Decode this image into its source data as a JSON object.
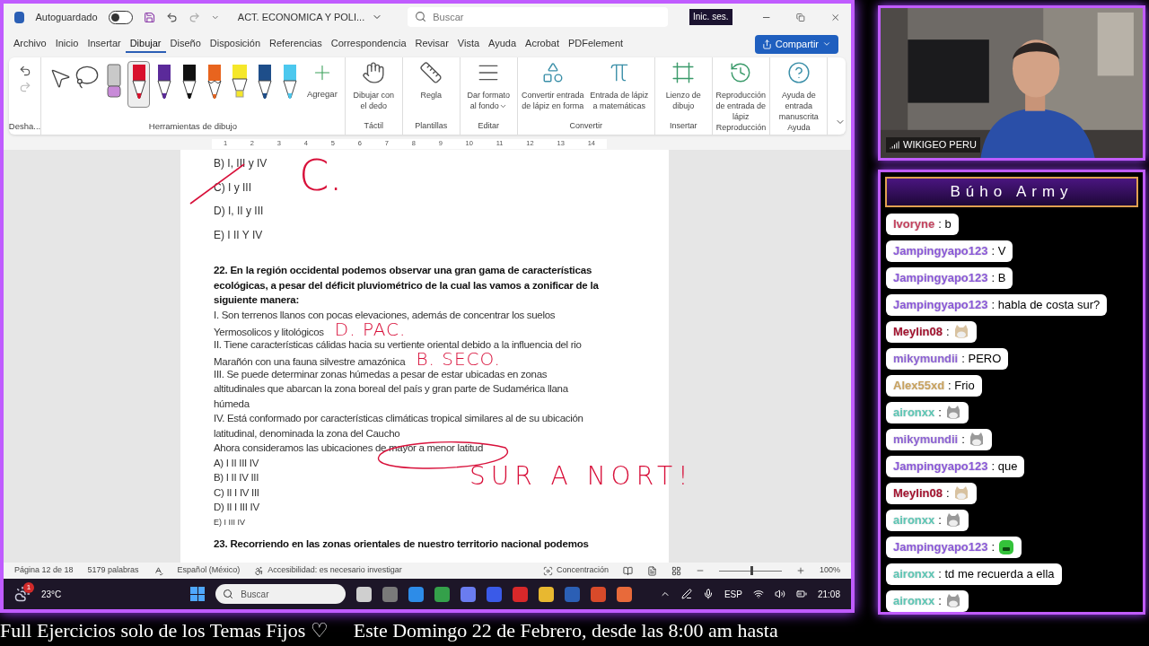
{
  "word": {
    "title_bar": {
      "autosave_label": "Autoguardado",
      "autosave_on": false,
      "doc_title": "ACT. ECONOMICA Y POLI...",
      "search_placeholder": "Buscar",
      "sign_in": "Inic. ses."
    },
    "menu": [
      {
        "label": "Archivo",
        "selected": false
      },
      {
        "label": "Inicio",
        "selected": false
      },
      {
        "label": "Insertar",
        "selected": false
      },
      {
        "label": "Dibujar",
        "selected": true
      },
      {
        "label": "Diseño",
        "selected": false
      },
      {
        "label": "Disposición",
        "selected": false
      },
      {
        "label": "Referencias",
        "selected": false
      },
      {
        "label": "Correspondencia",
        "selected": false
      },
      {
        "label": "Revisar",
        "selected": false
      },
      {
        "label": "Vista",
        "selected": false
      },
      {
        "label": "Ayuda",
        "selected": false
      },
      {
        "label": "Acrobat",
        "selected": false
      },
      {
        "label": "PDFelement",
        "selected": false
      }
    ],
    "share": "Compartir",
    "ribbon": {
      "undo_group": "Desha...",
      "tools_group": "Herramientas de dibujo",
      "add_label": "Agregar",
      "pens": [
        {
          "kind": "eraser",
          "color": "#c9c9c9",
          "selected": false
        },
        {
          "kind": "pen",
          "color": "#d8102c",
          "selected": true
        },
        {
          "kind": "pen",
          "color": "#5b2a9a",
          "selected": false
        },
        {
          "kind": "pen",
          "color": "#111111",
          "selected": false
        },
        {
          "kind": "pencil",
          "color": "#e8641e",
          "selected": false
        },
        {
          "kind": "highlighter",
          "color": "#f5e72a",
          "selected": false
        },
        {
          "kind": "pen",
          "color": "#1e4e8a",
          "selected": false
        },
        {
          "kind": "pen",
          "color": "#4cc8ee",
          "selected": false
        }
      ],
      "groups": [
        {
          "label": "Táctil",
          "buttons": [
            {
              "kind": "finger",
              "label": "Dibujar con el dedo"
            }
          ]
        },
        {
          "label": "Plantillas",
          "buttons": [
            {
              "kind": "ruler",
              "label": "Regla"
            }
          ]
        },
        {
          "label": "Editar",
          "buttons": [
            {
              "kind": "background",
              "label": "Dar formato al fondo",
              "menu": true
            }
          ]
        },
        {
          "label": "Convertir",
          "buttons": [
            {
              "kind": "shape",
              "label": "Convertir entrada de lápiz en forma"
            },
            {
              "kind": "math",
              "label": "Entrada de lápiz a matemáticas"
            }
          ]
        },
        {
          "label": "Insertar",
          "buttons": [
            {
              "kind": "canvas",
              "label": "Lienzo de dibujo"
            }
          ]
        },
        {
          "label": "Reproducción",
          "buttons": [
            {
              "kind": "replay",
              "label": "Reproducción de entrada de lápiz"
            }
          ]
        },
        {
          "label": "Ayuda",
          "buttons": [
            {
              "kind": "help",
              "label": "Ayuda de entrada manuscrita"
            }
          ]
        }
      ]
    },
    "ruler": [
      "1",
      "2",
      "3",
      "4",
      "5",
      "6",
      "7",
      "8",
      "9",
      "10",
      "11",
      "12",
      "13",
      "14"
    ],
    "document": {
      "lines": [
        {
          "kind": "option",
          "text": "B) I, III y IV",
          "struck": false
        },
        {
          "kind": "option",
          "text": "C) I y III",
          "struck": true
        },
        {
          "kind": "option",
          "text": "D) I, II y III",
          "struck": false
        },
        {
          "kind": "option",
          "text": "E) I II Y IV",
          "struck": false
        },
        {
          "kind": "question",
          "text": "22. En la región occidental podemos observar una gran gama de características"
        },
        {
          "kind": "question",
          "text": "ecológicas, a pesar del déficit pluviométrico de la cual las vamos a zonificar de la"
        },
        {
          "kind": "question",
          "text": "siguiente manera:"
        },
        {
          "kind": "body",
          "text": "I. Son terrenos llanos con pocas elevaciones, además de concentrar los suelos"
        },
        {
          "kind": "body",
          "text": "Yermosolicos y litológicos",
          "ink": "D. PAC."
        },
        {
          "kind": "body",
          "text": "II. Tiene características cálidas hacia su vertiente oriental debido a la influencia del rio"
        },
        {
          "kind": "body",
          "text": "Marañón con una fauna silvestre amazónica",
          "ink": "B. SECO."
        },
        {
          "kind": "body",
          "text": "III. Se puede determinar zonas húmedas a pesar de estar ubicadas en zonas"
        },
        {
          "kind": "body",
          "text": "altitudinales que abarcan la zona boreal del país y gran parte de Sudamérica llana"
        },
        {
          "kind": "body",
          "text": "húmeda"
        },
        {
          "kind": "body",
          "text": "IV. Está conformado por características climáticas tropical similares al de su ubicación"
        },
        {
          "kind": "body",
          "text": "latitudinal, denominada la zona del Caucho"
        },
        {
          "kind": "body",
          "text": "Ahora consideramos las ubicaciones de mayor a menor latitud",
          "circled": true
        },
        {
          "kind": "body",
          "text": "A) I II III IV"
        },
        {
          "kind": "body",
          "text": "B) I II IV III"
        },
        {
          "kind": "body",
          "text": "C) II I IV III"
        },
        {
          "kind": "body",
          "text": "D) II I III IV"
        },
        {
          "kind": "small",
          "text": "E) I III IV"
        },
        {
          "kind": "question",
          "text": "23. Recorriendo en las zonas orientales de nuestro territorio nacional podemos"
        }
      ],
      "answer_ink": "C.",
      "note_ink": "SUR A NORT!"
    },
    "status_bar": {
      "page": "Página 12 de 18",
      "words": "5179 palabras",
      "language": "Español (México)",
      "accessibility": "Accesibilidad: es necesario investigar",
      "focus": "Concentración",
      "zoom": {
        "level": 0.5,
        "reading": "100%"
      }
    }
  },
  "taskbar": {
    "weather_badge": "1",
    "temperature": "23°C",
    "search_placeholder": "Buscar",
    "language": "ESP",
    "time": "21:08"
  },
  "webcam": {
    "label": "WIKIGEO PERU"
  },
  "chat": {
    "title": "Búho Army",
    "messages": [
      {
        "user": "Ivoryne",
        "color": "#c4425e",
        "kind": "text",
        "text": ": b"
      },
      {
        "user": "Jampingyapo123",
        "color": "#8a58d8",
        "kind": "text",
        "text": ": V"
      },
      {
        "user": "Jampingyapo123",
        "color": "#8a58d8",
        "kind": "text",
        "text": ": B"
      },
      {
        "user": "Jampingyapo123",
        "color": "#8a58d8",
        "kind": "text",
        "text": ": habla de costa sur?"
      },
      {
        "user": "Meylin08",
        "color": "#a3122e",
        "kind": "beige-cat",
        "text": ":"
      },
      {
        "user": "mikymundii",
        "color": "#8d62d4",
        "kind": "text",
        "text": ": PERO"
      },
      {
        "user": "Alex55xd",
        "color": "#c9a25e",
        "kind": "text",
        "text": ": Frio"
      },
      {
        "user": "aironxx",
        "color": "#5cc6b4",
        "kind": "cat",
        "text": ":"
      },
      {
        "user": "mikymundii",
        "color": "#8d62d4",
        "kind": "cat",
        "text": ":"
      },
      {
        "user": "Jampingyapo123",
        "color": "#8a58d8",
        "kind": "text",
        "text": ": que"
      },
      {
        "user": "Meylin08",
        "color": "#a3122e",
        "kind": "beige-cat",
        "text": ":"
      },
      {
        "user": "aironxx",
        "color": "#5cc6b4",
        "kind": "cat",
        "text": ":"
      },
      {
        "user": "Jampingyapo123",
        "color": "#8a58d8",
        "kind": "green-face",
        "text": ":"
      },
      {
        "user": "aironxx",
        "color": "#5cc6b4",
        "kind": "text",
        "text": ": td me recuerda a ella"
      },
      {
        "user": "aironxx",
        "color": "#5cc6b4",
        "kind": "cat",
        "text": ":"
      }
    ]
  },
  "ticker": [
    "Full Ejercicios solo de los Temas Fijos ♡",
    "Este Domingo 22 de Febrero, desde las 8:00 am hasta"
  ]
}
